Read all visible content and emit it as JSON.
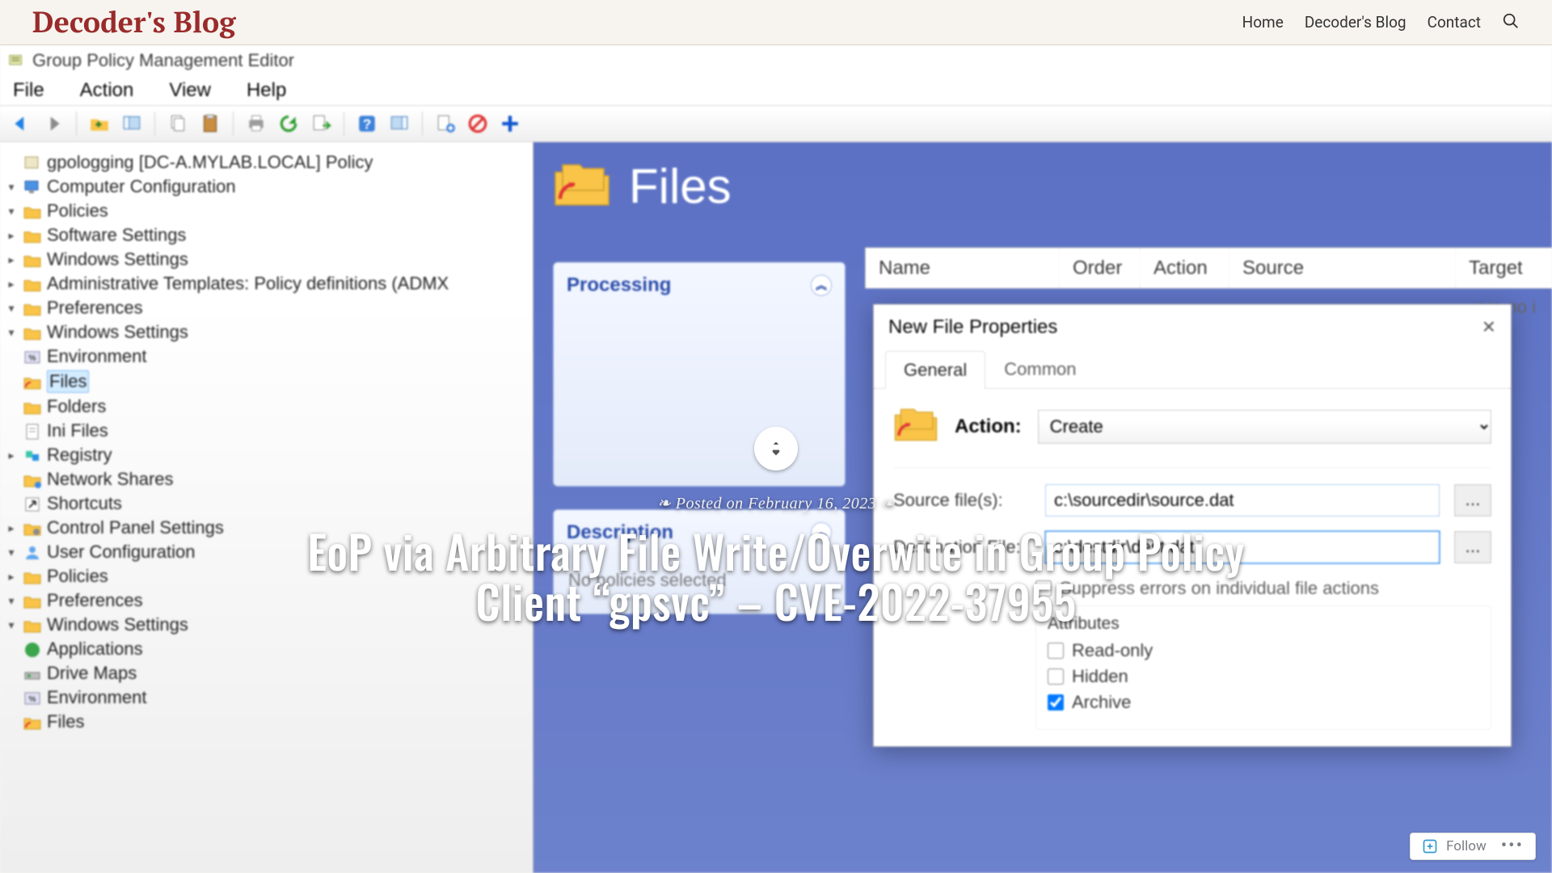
{
  "blog": {
    "title": "Decoder's Blog",
    "nav": {
      "home": "Home",
      "blog": "Decoder's Blog",
      "contact": "Contact"
    }
  },
  "hero": {
    "date_prefix": "Posted on ",
    "date": "February 16, 2023",
    "title": "EoP via Arbitrary File Write/Overwite in Group Policy Client “gpsvc” – CVE-2022-37955"
  },
  "gpme": {
    "window_title": "Group Policy Management Editor",
    "menus": [
      "File",
      "Action",
      "View",
      "Help"
    ],
    "tree": {
      "root": "gpologging [DC-A.MYLAB.LOCAL] Policy",
      "computer_configuration": "Computer Configuration",
      "policies": "Policies",
      "software_settings": "Software Settings",
      "windows_settings": "Windows Settings",
      "admin_templates": "Administrative Templates: Policy definitions (ADMX",
      "preferences": "Preferences",
      "pref_windows_settings": "Windows Settings",
      "environment": "Environment",
      "files": "Files",
      "folders": "Folders",
      "ini_files": "Ini Files",
      "registry": "Registry",
      "network_shares": "Network Shares",
      "shortcuts": "Shortcuts",
      "control_panel_settings": "Control Panel Settings",
      "user_configuration": "User Configuration",
      "uc_policies": "Policies",
      "uc_preferences": "Preferences",
      "uc_windows_settings": "Windows Settings",
      "uc_applications": "Applications",
      "uc_drive_maps": "Drive Maps",
      "uc_environment": "Environment",
      "uc_files": "Files"
    },
    "right": {
      "header": "Files",
      "panel_processing": "Processing",
      "panel_description": "Description",
      "description_body": "No policies selected",
      "columns": {
        "name": "Name",
        "order": "Order",
        "action": "Action",
        "source": "Source",
        "target": "Target"
      },
      "empty_msg": "are no i"
    },
    "dialog": {
      "title": "New File Properties",
      "tab_general": "General",
      "tab_common": "Common",
      "action_label": "Action:",
      "action_value": "Create",
      "source_label": "Source file(s):",
      "source_value": "c:\\sourcedir\\source.dat",
      "dest_label": "Destination File:",
      "dest_value": "c:\\destdir\\dest.dat",
      "suppress": "Suppress errors on individual file actions",
      "attributes": "Attributes",
      "readonly": "Read-only",
      "hidden": "Hidden",
      "archive": "Archive"
    }
  },
  "follow": {
    "label": "Follow"
  }
}
